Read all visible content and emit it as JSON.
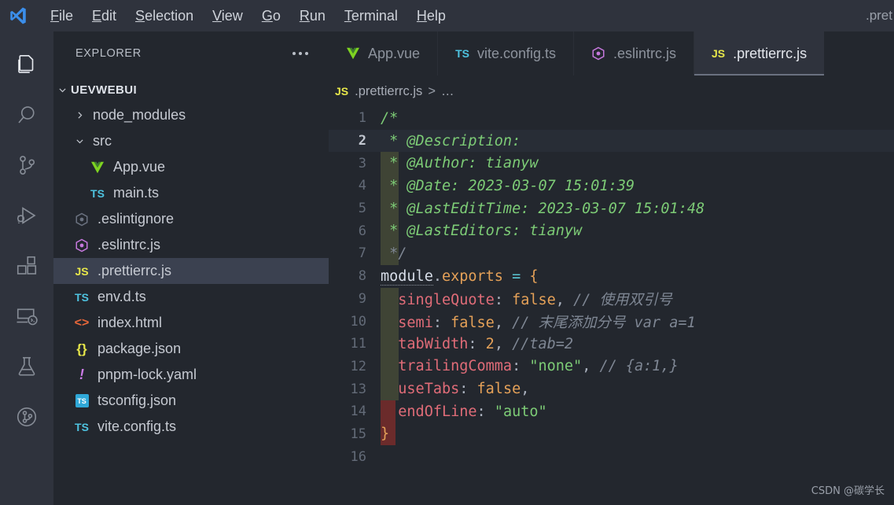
{
  "titlebar": {
    "logo": "vscode-logo",
    "menus": [
      "File",
      "Edit",
      "Selection",
      "View",
      "Go",
      "Run",
      "Terminal",
      "Help"
    ],
    "window_title": ".pret"
  },
  "activitybar": {
    "items": [
      {
        "name": "explorer-icon",
        "label": "Explorer",
        "active": true
      },
      {
        "name": "search-icon",
        "label": "Search",
        "active": false
      },
      {
        "name": "source-control-icon",
        "label": "Source Control",
        "active": false
      },
      {
        "name": "run-and-debug-icon",
        "label": "Run and Debug",
        "active": false
      },
      {
        "name": "extensions-icon",
        "label": "Extensions",
        "active": false
      },
      {
        "name": "remote-explorer-icon",
        "label": "Remote Explorer",
        "active": false
      },
      {
        "name": "testing-flask-icon",
        "label": "Testing",
        "active": false
      },
      {
        "name": "gitlens-icon",
        "label": "GitLens",
        "active": false
      }
    ]
  },
  "sidebar": {
    "title": "EXPLORER",
    "more_actions": "ellipsis-icon",
    "root": {
      "label": "UEVWEBUI",
      "expanded": true
    },
    "items": [
      {
        "label": "node_modules",
        "icon": "folder",
        "indent": 1,
        "expanded": false,
        "selected": false
      },
      {
        "label": "src",
        "icon": "folder",
        "indent": 1,
        "expanded": true,
        "selected": false
      },
      {
        "label": "App.vue",
        "icon": "vue",
        "indent": 2,
        "selected": false
      },
      {
        "label": "main.ts",
        "icon": "ts",
        "indent": 2,
        "selected": false
      },
      {
        "label": ".eslintignore",
        "icon": "eslint-gray",
        "indent": 1,
        "selected": false
      },
      {
        "label": ".eslintrc.js",
        "icon": "eslint-purple",
        "indent": 1,
        "selected": false
      },
      {
        "label": ".prettierrc.js",
        "icon": "js",
        "indent": 1,
        "selected": true
      },
      {
        "label": "env.d.ts",
        "icon": "ts",
        "indent": 1,
        "selected": false
      },
      {
        "label": "index.html",
        "icon": "html",
        "indent": 1,
        "selected": false
      },
      {
        "label": "package.json",
        "icon": "json",
        "indent": 1,
        "selected": false
      },
      {
        "label": "pnpm-lock.yaml",
        "icon": "yaml",
        "indent": 1,
        "selected": false
      },
      {
        "label": "tsconfig.json",
        "icon": "tsconfig",
        "indent": 1,
        "selected": false
      },
      {
        "label": "vite.config.ts",
        "icon": "ts",
        "indent": 1,
        "selected": false
      }
    ]
  },
  "tabs": [
    {
      "label": "App.vue",
      "icon": "vue",
      "active": false
    },
    {
      "label": "vite.config.ts",
      "icon": "ts",
      "active": false
    },
    {
      "label": ".eslintrc.js",
      "icon": "eslint-purple",
      "active": false
    },
    {
      "label": ".prettierrc.js",
      "icon": "js",
      "active": true
    }
  ],
  "breadcrumb": {
    "icon": "JS",
    "file": ".prettierrc.js",
    "separator": ">",
    "tail": "…"
  },
  "editor": {
    "active_line": 2,
    "lines": [
      {
        "n": 1,
        "tokens": [
          {
            "t": "/*",
            "c": "c-comment"
          }
        ]
      },
      {
        "n": 2,
        "tokens": [
          {
            "t": " * @Description:",
            "c": "c-comment"
          }
        ]
      },
      {
        "n": 3,
        "tokens": [
          {
            "t": " * @Author: tianyw",
            "c": "c-comment"
          }
        ]
      },
      {
        "n": 4,
        "tokens": [
          {
            "t": " * @Date: 2023-03-07 15:01:39",
            "c": "c-comment"
          }
        ]
      },
      {
        "n": 5,
        "tokens": [
          {
            "t": " * @LastEditTime: 2023-03-07 15:01:48",
            "c": "c-comment"
          }
        ]
      },
      {
        "n": 6,
        "tokens": [
          {
            "t": " * @LastEditors: tianyw",
            "c": "c-comment"
          }
        ]
      },
      {
        "n": 7,
        "tokens": [
          {
            "t": " */",
            "c": "c-comment2"
          }
        ]
      },
      {
        "n": 8,
        "tokens": [
          {
            "t": "module",
            "c": "c-ident underline-dot"
          },
          {
            "t": ".",
            "c": "c-punc"
          },
          {
            "t": "exports",
            "c": "c-member"
          },
          {
            "t": " ",
            "c": "c-punc"
          },
          {
            "t": "=",
            "c": "c-op"
          },
          {
            "t": " ",
            "c": "c-punc"
          },
          {
            "t": "{",
            "c": "c-brace"
          }
        ]
      },
      {
        "n": 9,
        "tokens": [
          {
            "t": "  ",
            "c": "c-punc"
          },
          {
            "t": "singleQuote",
            "c": "c-prop"
          },
          {
            "t": ":",
            "c": "c-punc"
          },
          {
            "t": " ",
            "c": "c-punc"
          },
          {
            "t": "false",
            "c": "c-bool"
          },
          {
            "t": ",",
            "c": "c-punc"
          },
          {
            "t": " // 使用双引号",
            "c": "c-comment2"
          }
        ]
      },
      {
        "n": 10,
        "tokens": [
          {
            "t": "  ",
            "c": "c-punc"
          },
          {
            "t": "semi",
            "c": "c-prop"
          },
          {
            "t": ":",
            "c": "c-punc"
          },
          {
            "t": " ",
            "c": "c-punc"
          },
          {
            "t": "false",
            "c": "c-bool"
          },
          {
            "t": ",",
            "c": "c-punc"
          },
          {
            "t": " // 末尾添加分号 var a=1",
            "c": "c-comment2"
          }
        ]
      },
      {
        "n": 11,
        "tokens": [
          {
            "t": "  ",
            "c": "c-punc"
          },
          {
            "t": "tabWidth",
            "c": "c-prop"
          },
          {
            "t": ":",
            "c": "c-punc"
          },
          {
            "t": " ",
            "c": "c-punc"
          },
          {
            "t": "2",
            "c": "c-num"
          },
          {
            "t": ",",
            "c": "c-punc"
          },
          {
            "t": " //tab=2",
            "c": "c-comment2"
          }
        ]
      },
      {
        "n": 12,
        "tokens": [
          {
            "t": "  ",
            "c": "c-punc"
          },
          {
            "t": "trailingComma",
            "c": "c-prop"
          },
          {
            "t": ":",
            "c": "c-punc"
          },
          {
            "t": " ",
            "c": "c-punc"
          },
          {
            "t": "\"none\"",
            "c": "c-str"
          },
          {
            "t": ",",
            "c": "c-punc"
          },
          {
            "t": " // {a:1,}",
            "c": "c-comment2"
          }
        ]
      },
      {
        "n": 13,
        "tokens": [
          {
            "t": "  ",
            "c": "c-punc"
          },
          {
            "t": "useTabs",
            "c": "c-prop"
          },
          {
            "t": ":",
            "c": "c-punc"
          },
          {
            "t": " ",
            "c": "c-punc"
          },
          {
            "t": "false",
            "c": "c-bool"
          },
          {
            "t": ",",
            "c": "c-punc"
          }
        ]
      },
      {
        "n": 14,
        "tokens": [
          {
            "t": "  ",
            "c": "c-punc"
          },
          {
            "t": "endOfLine",
            "c": "c-prop"
          },
          {
            "t": ":",
            "c": "c-punc"
          },
          {
            "t": " ",
            "c": "c-punc"
          },
          {
            "t": "\"auto\"",
            "c": "c-str"
          }
        ]
      },
      {
        "n": 15,
        "tokens": [
          {
            "t": "}",
            "c": "c-brace"
          }
        ]
      },
      {
        "n": 16,
        "tokens": []
      }
    ]
  },
  "watermark": "CSDN @碳学长",
  "colors": {
    "titlebar_bg": "#2f333d",
    "activitybar_bg": "#2f333d",
    "sidebar_bg": "#23272e",
    "editor_bg": "#23272e",
    "active_tab_bg": "#2f333d",
    "selection_bg": "#3b4150",
    "comment_green": "#7dcc76",
    "property_red": "#e06c78",
    "value_orange": "#e5a158",
    "string_green": "#7dcc76",
    "operator_cyan": "#5bc8d6"
  }
}
